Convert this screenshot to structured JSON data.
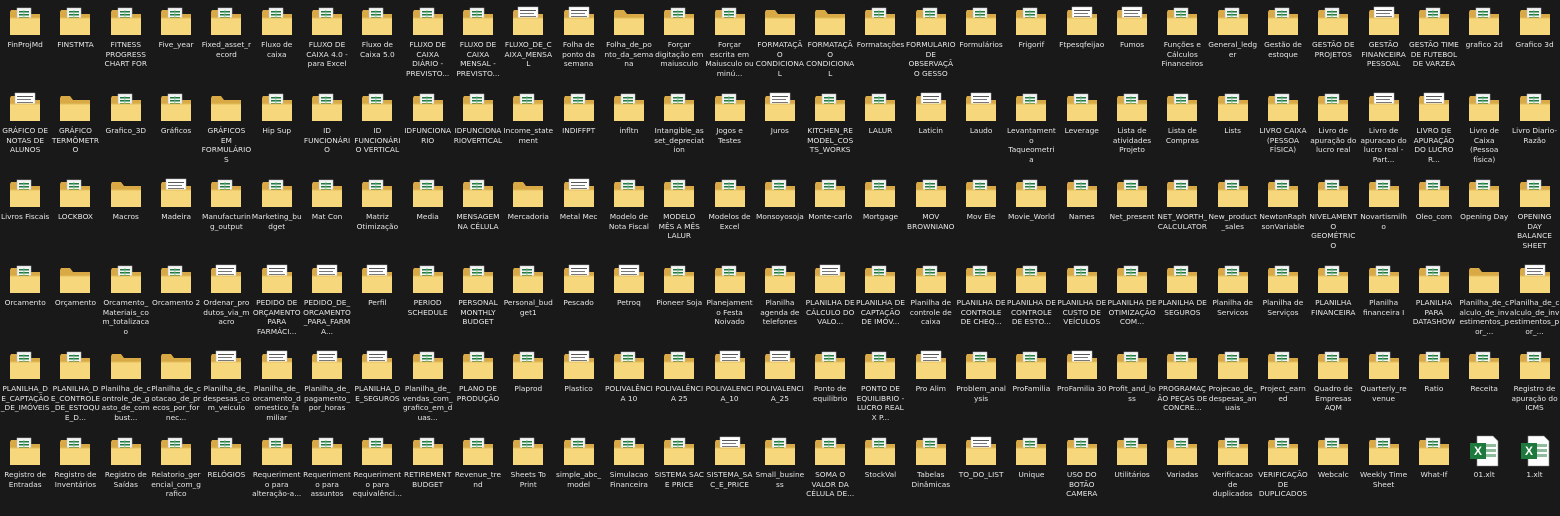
{
  "desktop": {
    "background": "#191919",
    "colors": {
      "folder_back": "#d9a945",
      "folder_front": "#f6d77c",
      "excel_green": "#1d7a3c",
      "paper": "#f3f3f3",
      "label_text": "#e6e6e6"
    },
    "items": [
      {
        "label": "FinProjMd",
        "icon": "excel-folder-icon"
      },
      {
        "label": "FINSTMTA",
        "icon": "excel-folder-icon"
      },
      {
        "label": "FITNESS PROGRESS CHART FOR",
        "icon": "excel-folder-icon"
      },
      {
        "label": "Five_year",
        "icon": "excel-folder-icon"
      },
      {
        "label": "Fixed_asset_record",
        "icon": "excel-folder-icon"
      },
      {
        "label": "Fluxo de caixa",
        "icon": "excel-folder-icon"
      },
      {
        "label": "FLUXO DE CAIXA 4.0 - para Excel",
        "icon": "excel-folder-icon"
      },
      {
        "label": "Fluxo de Caixa 5.0",
        "icon": "excel-folder-icon"
      },
      {
        "label": "FLUXO DE CAIXA DIÁRIO - PREVISTO...",
        "icon": "excel-folder-icon"
      },
      {
        "label": "FLUXO DE CAIXA MENSAL - PREVISTO...",
        "icon": "excel-folder-icon"
      },
      {
        "label": "FLUXO_DE_CAIXA_MENSAL",
        "icon": "document-folder-icon"
      },
      {
        "label": "Folha de ponto da semana",
        "icon": "document-folder-icon"
      },
      {
        "label": "Folha_de_ponto_da_semana",
        "icon": "folder-icon"
      },
      {
        "label": "Forçar digitação em maiusculo",
        "icon": "excel-folder-icon"
      },
      {
        "label": "Forçar escrita em Maiusculo ou minú...",
        "icon": "excel-folder-icon"
      },
      {
        "label": "FORMATAÇÃO CONDICIONAL",
        "icon": "folder-icon"
      },
      {
        "label": "FORMATAÇÃO CONDICIONAL",
        "icon": "folder-icon"
      },
      {
        "label": "Formatações",
        "icon": "excel-folder-icon"
      },
      {
        "label": "FORMULARIO DE OBSERVAÇÃO GESSO",
        "icon": "excel-folder-icon"
      },
      {
        "label": "Formulários",
        "icon": "excel-folder-icon"
      },
      {
        "label": "Frigorif",
        "icon": "excel-folder-icon"
      },
      {
        "label": "Ftpesqfeijao",
        "icon": "document-folder-icon"
      },
      {
        "label": "Fumos",
        "icon": "document-folder-icon"
      },
      {
        "label": "Funções e Cálculos Financeiros",
        "icon": "excel-folder-icon"
      },
      {
        "label": "General_ledger",
        "icon": "excel-folder-icon"
      },
      {
        "label": "Gestão de estoque",
        "icon": "excel-folder-icon"
      },
      {
        "label": "GESTÃO DE PROJETOS",
        "icon": "excel-folder-icon"
      },
      {
        "label": "GESTÃO FINANCEIRA PESSOAL",
        "icon": "document-folder-icon"
      },
      {
        "label": "GESTÃO TIME DE FUTEBOL DE VARZEA",
        "icon": "excel-folder-icon"
      },
      {
        "label": "grafico 2d",
        "icon": "excel-folder-icon"
      },
      {
        "label": "Grafico 3d",
        "icon": "excel-folder-icon"
      },
      {
        "label": "GRÁFICO DE NOTAS DE ALUNOS",
        "icon": "document-folder-icon"
      },
      {
        "label": "GRÁFICO TERMÔMETRO",
        "icon": "folder-icon"
      },
      {
        "label": "Grafico_3D",
        "icon": "excel-folder-icon"
      },
      {
        "label": "Gráficos",
        "icon": "excel-folder-icon"
      },
      {
        "label": "GRÁFICOS EM FORMULÁRIOS",
        "icon": "folder-icon"
      },
      {
        "label": "Hip Sup",
        "icon": "excel-folder-icon"
      },
      {
        "label": "ID FUNCIONÁRIO",
        "icon": "excel-folder-icon"
      },
      {
        "label": "ID FUNCIONÁRIO VERTICAL",
        "icon": "excel-folder-icon"
      },
      {
        "label": "IDFUNCIONARIO",
        "icon": "excel-folder-icon"
      },
      {
        "label": "IDFUNCIONARIOVERTICAL",
        "icon": "excel-folder-icon"
      },
      {
        "label": "Income_statement",
        "icon": "excel-folder-icon"
      },
      {
        "label": "INDIFFPT",
        "icon": "excel-folder-icon"
      },
      {
        "label": "infltn",
        "icon": "excel-folder-icon"
      },
      {
        "label": "Intangible_asset_depreciation",
        "icon": "excel-folder-icon"
      },
      {
        "label": "Jogos e Testes",
        "icon": "excel-folder-icon"
      },
      {
        "label": "Juros",
        "icon": "document-folder-icon"
      },
      {
        "label": "KITCHEN_REMODEL_COSTS_WORKS",
        "icon": "excel-folder-icon"
      },
      {
        "label": "LALUR",
        "icon": "excel-folder-icon"
      },
      {
        "label": "Laticin",
        "icon": "document-folder-icon"
      },
      {
        "label": "Laudo",
        "icon": "document-folder-icon"
      },
      {
        "label": "Levantamento Taqueometria",
        "icon": "excel-folder-icon"
      },
      {
        "label": "Leverage",
        "icon": "excel-folder-icon"
      },
      {
        "label": "Lista de atividades Projeto",
        "icon": "excel-folder-icon"
      },
      {
        "label": "Lista de Compras",
        "icon": "excel-folder-icon"
      },
      {
        "label": "Lists",
        "icon": "excel-folder-icon"
      },
      {
        "label": "LIVRO CAIXA (PESSOA FÍSICA)",
        "icon": "excel-folder-icon"
      },
      {
        "label": "Livro de apuração do lucro real",
        "icon": "excel-folder-icon"
      },
      {
        "label": "Livro de apuracao do lucro real - Part...",
        "icon": "document-folder-icon"
      },
      {
        "label": "LIVRO DE APURAÇÃO DO LUCRO R...",
        "icon": "document-folder-icon"
      },
      {
        "label": "Livro de Caixa (Pessoa física)",
        "icon": "excel-folder-icon"
      },
      {
        "label": "Livro Diario-Razão",
        "icon": "excel-folder-icon"
      },
      {
        "label": "Livros Fiscais",
        "icon": "excel-folder-icon"
      },
      {
        "label": "LOCKBOX",
        "icon": "excel-folder-icon"
      },
      {
        "label": "Macros",
        "icon": "folder-icon"
      },
      {
        "label": "Madeira",
        "icon": "document-folder-icon"
      },
      {
        "label": "Manufacturing_output",
        "icon": "excel-folder-icon"
      },
      {
        "label": "Marketing_budget",
        "icon": "excel-folder-icon"
      },
      {
        "label": "Mat Con",
        "icon": "excel-folder-icon"
      },
      {
        "label": "Matriz Otimização",
        "icon": "excel-folder-icon"
      },
      {
        "label": "Media",
        "icon": "excel-folder-icon"
      },
      {
        "label": "MENSAGEM NA CÉLULA",
        "icon": "excel-folder-icon"
      },
      {
        "label": "Mercadoria",
        "icon": "folder-icon"
      },
      {
        "label": "Metal Mec",
        "icon": "document-folder-icon"
      },
      {
        "label": "Modelo de Nota Fiscal",
        "icon": "excel-folder-icon"
      },
      {
        "label": "MODELO MÊS A MÊS LALUR",
        "icon": "excel-folder-icon"
      },
      {
        "label": "Modelos de Excel",
        "icon": "excel-folder-icon"
      },
      {
        "label": "Monsoyosoja",
        "icon": "excel-folder-icon"
      },
      {
        "label": "Monte-carlo",
        "icon": "excel-folder-icon"
      },
      {
        "label": "Mortgage",
        "icon": "excel-folder-icon"
      },
      {
        "label": "MOV BROWNIANO",
        "icon": "excel-folder-icon"
      },
      {
        "label": "Mov Ele",
        "icon": "excel-folder-icon"
      },
      {
        "label": "Movie_World",
        "icon": "excel-folder-icon"
      },
      {
        "label": "Names",
        "icon": "excel-folder-icon"
      },
      {
        "label": "Net_present",
        "icon": "excel-folder-icon"
      },
      {
        "label": "NET_WORTH_CALCULATOR",
        "icon": "excel-folder-icon"
      },
      {
        "label": "New_product_sales",
        "icon": "excel-folder-icon"
      },
      {
        "label": "NewtonRaphsonVariable",
        "icon": "excel-folder-icon"
      },
      {
        "label": "NIVELAMENTO GEOMÉTRICO",
        "icon": "excel-folder-icon"
      },
      {
        "label": "Novartismilho",
        "icon": "excel-folder-icon"
      },
      {
        "label": "Oleo_com",
        "icon": "excel-folder-icon"
      },
      {
        "label": "Opening Day",
        "icon": "excel-folder-icon"
      },
      {
        "label": "OPENING DAY BALANCE SHEET",
        "icon": "excel-folder-icon"
      },
      {
        "label": "Orcamento",
        "icon": "excel-folder-icon"
      },
      {
        "label": "Orçamento",
        "icon": "folder-icon"
      },
      {
        "label": "Orcamento_Materiais_com_totalizacao",
        "icon": "excel-folder-icon"
      },
      {
        "label": "Orcamento 2",
        "icon": "excel-folder-icon"
      },
      {
        "label": "Ordenar_produtos_via_macro",
        "icon": "document-folder-icon"
      },
      {
        "label": "PEDIDO DE ORÇAMENTO PARA FARMÁCI...",
        "icon": "document-folder-icon"
      },
      {
        "label": "PEDIDO_DE_ORCAMENTO_PARA_FARMA...",
        "icon": "document-folder-icon"
      },
      {
        "label": "Perfil",
        "icon": "document-folder-icon"
      },
      {
        "label": "PERIOD SCHEDULE",
        "icon": "excel-folder-icon"
      },
      {
        "label": "PERSONAL MONTHLY BUDGET",
        "icon": "excel-folder-icon"
      },
      {
        "label": "Personal_budget1",
        "icon": "excel-folder-icon"
      },
      {
        "label": "Pescado",
        "icon": "document-folder-icon"
      },
      {
        "label": "Petroq",
        "icon": "document-folder-icon"
      },
      {
        "label": "Pioneer Soja",
        "icon": "excel-folder-icon"
      },
      {
        "label": "Planejamento Festa Noivado",
        "icon": "excel-folder-icon"
      },
      {
        "label": "Planilha agenda de telefones",
        "icon": "excel-folder-icon"
      },
      {
        "label": "PLANILHA DE CÁLCULO DO VALO...",
        "icon": "document-folder-icon"
      },
      {
        "label": "PLANILHA DE CAPTAÇÃO DE IMÓV...",
        "icon": "excel-folder-icon"
      },
      {
        "label": "Planilha de controle de caixa",
        "icon": "excel-folder-icon"
      },
      {
        "label": "PLANILHA DE CONTROLE DE CHEQ...",
        "icon": "excel-folder-icon"
      },
      {
        "label": "PLANILHA DE CONTROLE DE ESTO...",
        "icon": "excel-folder-icon"
      },
      {
        "label": "PLANILHA DE CUSTO DE VEÍCULOS",
        "icon": "excel-folder-icon"
      },
      {
        "label": "PLANILHA DE OTIMIZAÇÃO COM...",
        "icon": "excel-folder-icon"
      },
      {
        "label": "PLANILHA DE SEGUROS",
        "icon": "excel-folder-icon"
      },
      {
        "label": "Planilha de Servicos",
        "icon": "excel-folder-icon"
      },
      {
        "label": "Planilha de Serviços",
        "icon": "excel-folder-icon"
      },
      {
        "label": "PLANILHA FINANCEIRA",
        "icon": "excel-folder-icon"
      },
      {
        "label": "Planilha financeira I",
        "icon": "excel-folder-icon"
      },
      {
        "label": "PLANILHA PARA DATASHOW",
        "icon": "excel-folder-icon"
      },
      {
        "label": "Planilha_de_calculo_de_investimentos_por_...",
        "icon": "folder-icon"
      },
      {
        "label": "Planilha_de_calculo_de_investimentos_por_...",
        "icon": "document-folder-icon"
      },
      {
        "label": "PLANILHA_DE_CAPTAÇÃO_DE_IMÓVEIS",
        "icon": "excel-folder-icon"
      },
      {
        "label": "PLANILHA_DE_CONTROLE_DE_ESTOQUE_D...",
        "icon": "excel-folder-icon"
      },
      {
        "label": "Planilha_de_controle_de_gasto_de_combust...",
        "icon": "folder-icon"
      },
      {
        "label": "Planilha_de_cotacao_de_precos_por_fornec...",
        "icon": "folder-icon"
      },
      {
        "label": "Planilha_de_despesas_com_veiculo",
        "icon": "document-folder-icon"
      },
      {
        "label": "Planilha_de_orcamento_domestico_familiar",
        "icon": "document-folder-icon"
      },
      {
        "label": "Planilha_de_pagamento_por_horas",
        "icon": "document-folder-icon"
      },
      {
        "label": "PLANILHA_DE_SEGUROS",
        "icon": "document-folder-icon"
      },
      {
        "label": "Planilha_de_vendas_com_grafico_em_duas...",
        "icon": "excel-folder-icon"
      },
      {
        "label": "PLANO DE PRODUÇÃO",
        "icon": "excel-folder-icon"
      },
      {
        "label": "Plaprod",
        "icon": "excel-folder-icon"
      },
      {
        "label": "Plastico",
        "icon": "document-folder-icon"
      },
      {
        "label": "POLIVALÊNCIA 10",
        "icon": "excel-folder-icon"
      },
      {
        "label": "POLIVALÊNCIA 25",
        "icon": "excel-folder-icon"
      },
      {
        "label": "POLIVALENCIA_10",
        "icon": "document-folder-icon"
      },
      {
        "label": "POLIVALENCIA_25",
        "icon": "document-folder-icon"
      },
      {
        "label": "Ponto de equilibrio",
        "icon": "excel-folder-icon"
      },
      {
        "label": "PONTO DE EQUILIBRIO - LUCRO REAL X P...",
        "icon": "excel-folder-icon"
      },
      {
        "label": "Pro Alim",
        "icon": "document-folder-icon"
      },
      {
        "label": "Problem_analysis",
        "icon": "excel-folder-icon"
      },
      {
        "label": "ProFamilia",
        "icon": "excel-folder-icon"
      },
      {
        "label": "ProFamilia 30",
        "icon": "document-folder-icon"
      },
      {
        "label": "Profit_and_loss",
        "icon": "excel-folder-icon"
      },
      {
        "label": "PROGRAMAÇÃO PEÇAS DE CONCRE...",
        "icon": "excel-folder-icon"
      },
      {
        "label": "Projecao_de_despesas_anuais",
        "icon": "excel-folder-icon"
      },
      {
        "label": "Project_earned",
        "icon": "excel-folder-icon"
      },
      {
        "label": "Quadro de Empresas AQM",
        "icon": "excel-folder-icon"
      },
      {
        "label": "Quarterly_revenue",
        "icon": "excel-folder-icon"
      },
      {
        "label": "Ratio",
        "icon": "excel-folder-icon"
      },
      {
        "label": "Receita",
        "icon": "excel-folder-icon"
      },
      {
        "label": "Registro de apuração do ICMS",
        "icon": "excel-folder-icon"
      },
      {
        "label": "Registro de Entradas",
        "icon": "excel-folder-icon"
      },
      {
        "label": "Registro de Inventários",
        "icon": "excel-folder-icon"
      },
      {
        "label": "Registro de Saídas",
        "icon": "excel-folder-icon"
      },
      {
        "label": "Relatorio_gerencial_com_grafico",
        "icon": "excel-folder-icon"
      },
      {
        "label": "RELÓGIOS",
        "icon": "excel-folder-icon"
      },
      {
        "label": "Requerimento para alteração-a...",
        "icon": "excel-folder-icon"
      },
      {
        "label": "Requerimento para assuntos",
        "icon": "excel-folder-icon"
      },
      {
        "label": "Requerimento para equivalênci...",
        "icon": "excel-folder-icon"
      },
      {
        "label": "RETIREMENT BUDGET",
        "icon": "excel-folder-icon"
      },
      {
        "label": "Revenue_trend",
        "icon": "excel-folder-icon"
      },
      {
        "label": "Sheets To Print",
        "icon": "excel-folder-icon"
      },
      {
        "label": "simple_abc_model",
        "icon": "excel-folder-icon"
      },
      {
        "label": "Simulacao Financeira",
        "icon": "excel-folder-icon"
      },
      {
        "label": "SISTEMA SAC E PRICE",
        "icon": "excel-folder-icon"
      },
      {
        "label": "SISTEMA_SAC_E_PRICE",
        "icon": "document-folder-icon"
      },
      {
        "label": "Small_business",
        "icon": "excel-folder-icon"
      },
      {
        "label": "SOMA O VALOR DA CÉLULA DE...",
        "icon": "excel-folder-icon"
      },
      {
        "label": "StockVal",
        "icon": "excel-folder-icon"
      },
      {
        "label": "Tabelas Dinâmicas",
        "icon": "excel-folder-icon"
      },
      {
        "label": "TO_DO_LIST",
        "icon": "document-folder-icon"
      },
      {
        "label": "Unique",
        "icon": "excel-folder-icon"
      },
      {
        "label": "USO DO BOTÃO CAMERA",
        "icon": "excel-folder-icon"
      },
      {
        "label": "Utilitários",
        "icon": "excel-folder-icon"
      },
      {
        "label": "Variadas",
        "icon": "excel-folder-icon"
      },
      {
        "label": "Verificacao de duplicados",
        "icon": "excel-folder-icon"
      },
      {
        "label": "VERIFICAÇÃO DE DUPLICADOS",
        "icon": "excel-folder-icon"
      },
      {
        "label": "Webcalc",
        "icon": "excel-folder-icon"
      },
      {
        "label": "Weekly Time Sheet",
        "icon": "excel-folder-icon"
      },
      {
        "label": "What-If",
        "icon": "excel-folder-icon"
      },
      {
        "label": "01.xlt",
        "icon": "excel-file-icon"
      },
      {
        "label": "1.xlt",
        "icon": "excel-file-icon"
      }
    ]
  }
}
